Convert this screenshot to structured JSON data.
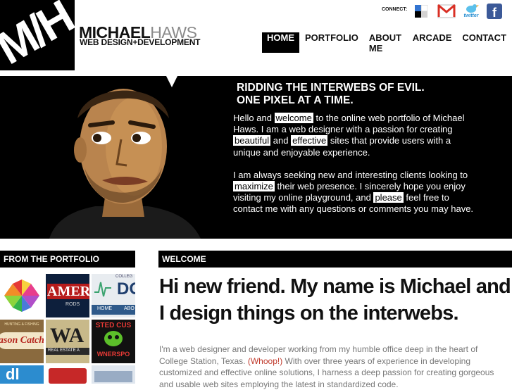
{
  "logo": {
    "mark": "M/H"
  },
  "brand": {
    "name_first": "MICHAEL",
    "name_last": "HAWS",
    "tagline": "WEB DESIGN+DEVELOPMENT"
  },
  "connect": {
    "label": "CONNECT:",
    "twitter": "twitter",
    "facebook": "f"
  },
  "nav": {
    "home": "HOME",
    "portfolio": "PORTFOLIO",
    "about": "ABOUT ME",
    "arcade": "ARCADE",
    "contact": "CONTACT"
  },
  "hero": {
    "headline_1": "RIDDING THE INTERWEBS OF EVIL.",
    "headline_2": "ONE PIXEL AT A TIME.",
    "p1": {
      "s1": "Hello and ",
      "h1": "welcome",
      "s2": " to the online web portfolio of Michael Haws. I am a web designer with a passion for creating ",
      "h2": "beautiful",
      "s3": " and ",
      "h3": "effective",
      "s4": " sites that provide users with a unique and enjoyable experience."
    },
    "p2": {
      "s1": "I am always seeking new and interesting clients looking to ",
      "h1": "maximize",
      "s2": " their web presence. I sincerely hope you enjoy visiting my online playground, and ",
      "h2": "please",
      "s3": " feel free to contact me with any questions or comments you may have."
    }
  },
  "portfolio": {
    "heading": "FROM THE PORTFOLIO",
    "thumbs": {
      "t2": "AMER",
      "t2b": "RODS",
      "t3_top": "COLLEG",
      "t3_big": "DO",
      "t3_tab1": "HOME",
      "t3_tab2": "ABO",
      "t4": "ason Catch",
      "t4b": "HUNTING & FISHING",
      "t5": "WA",
      "t5b": "REAL ESTATE A",
      "t6": "STED CUS",
      "t6b": "WNERSPO",
      "t7": "dl"
    }
  },
  "welcome": {
    "heading": "WELCOME",
    "title": "Hi new friend. My name is Michael and I design things on the interwebs.",
    "body_1": "I'm a web designer and developer working from my humble office deep in the heart of College Station, Texas. ",
    "body_whoop": "(Whoop!)",
    "body_2": " With over three years of experience in developing customized and effective online solutions, I harness a deep passion for creating gorgeous and usable web sites employing the latest in standardized code."
  },
  "colors": {
    "black": "#000000",
    "accent_red": "#c0392b",
    "gray_text": "#777777"
  }
}
